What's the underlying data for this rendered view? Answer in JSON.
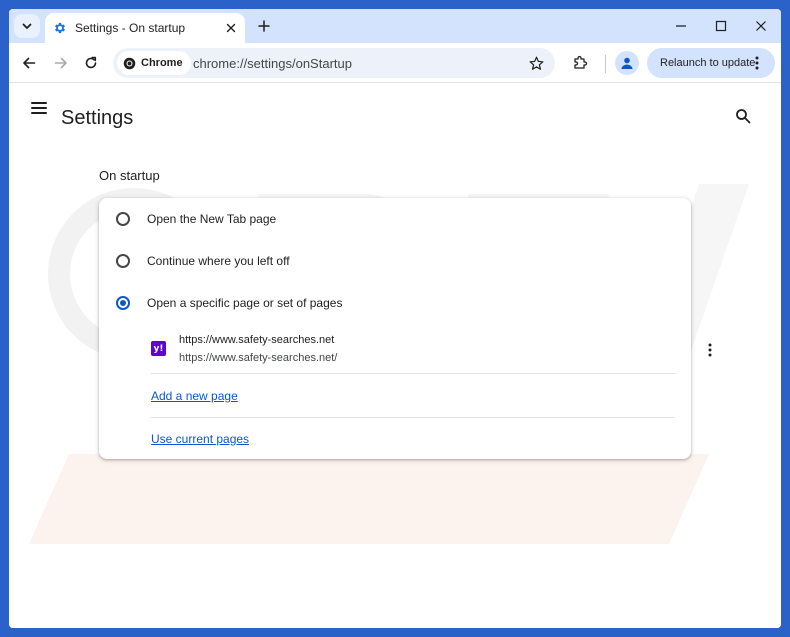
{
  "window": {
    "tab_title": "Settings - On startup",
    "controls": {
      "minimize": "minimize",
      "maximize": "maximize",
      "close": "close"
    }
  },
  "toolbar": {
    "chip_label": "Chrome",
    "url": "chrome://settings/onStartup",
    "relaunch_label": "Relaunch to update"
  },
  "settings": {
    "title": "Settings",
    "section_label": "On startup",
    "options": [
      {
        "label": "Open the New Tab page",
        "checked": false
      },
      {
        "label": "Continue where you left off",
        "checked": false
      },
      {
        "label": "Open a specific page or set of pages",
        "checked": true
      }
    ],
    "startup_page": {
      "title": "https://www.safety-searches.net",
      "url": "https://www.safety-searches.net/",
      "favicon_text": "y!"
    },
    "add_page_label": "Add a new page",
    "use_current_label": "Use current pages"
  },
  "colors": {
    "frame": "#2b62c9",
    "tabstrip": "#d3e3fd",
    "accent": "#0b57d0",
    "favicon": "#6001d2"
  },
  "icons": [
    "chevron-down-icon",
    "gear-icon",
    "close-icon",
    "plus-icon",
    "back-icon",
    "forward-icon",
    "reload-icon",
    "chrome-logo-icon",
    "star-icon",
    "extension-icon",
    "profile-icon",
    "more-vert-icon",
    "hamburger-icon",
    "search-icon"
  ]
}
